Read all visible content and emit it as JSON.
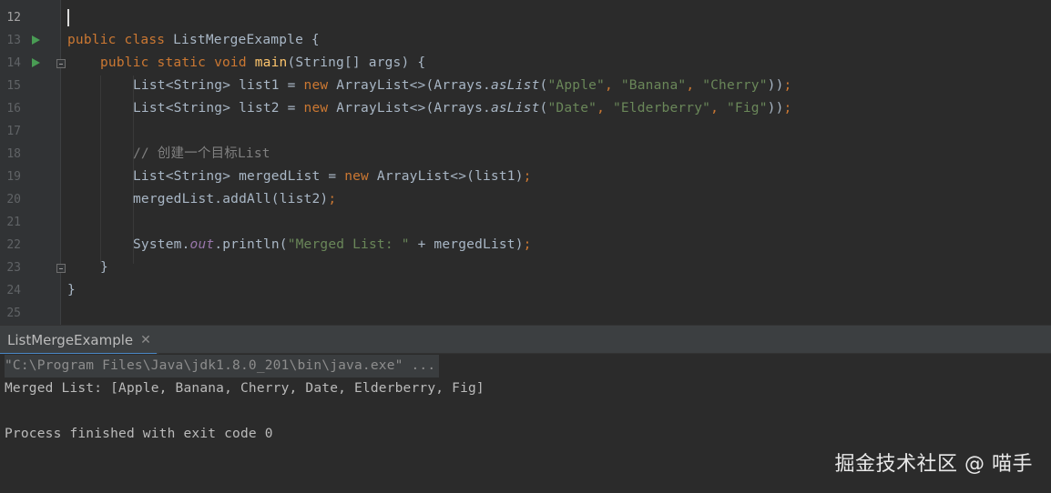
{
  "editor": {
    "line_numbers": [
      "12",
      "13",
      "14",
      "15",
      "16",
      "17",
      "18",
      "19",
      "20",
      "21",
      "22",
      "23",
      "24",
      "25"
    ],
    "lines": {
      "l13": {
        "kw1": "public",
        "kw2": "class",
        "rest": " ListMergeExample {"
      },
      "l14": {
        "kw1": "public",
        "kw2": "static",
        "kw3": "void",
        "fn": "main",
        "rest": "(String[] args) {"
      },
      "l15": {
        "a": "List<String> list1 = ",
        "kw": "new",
        "b": " ArrayList<>(Arrays.",
        "m": "asList",
        "c": "(",
        "s1": "\"Apple\"",
        "sep1": ", ",
        "s2": "\"Banana\"",
        "sep2": ", ",
        "s3": "\"Cherry\"",
        "end": "))",
        "semi": ";"
      },
      "l16": {
        "a": "List<String> list2 = ",
        "kw": "new",
        "b": " ArrayList<>(Arrays.",
        "m": "asList",
        "c": "(",
        "s1": "\"Date\"",
        "sep1": ", ",
        "s2": "\"Elderberry\"",
        "sep2": ", ",
        "s3": "\"Fig\"",
        "end": "))",
        "semi": ";"
      },
      "l18": {
        "comment": "// 创建一个目标List"
      },
      "l19": {
        "a": "List<String> mergedList = ",
        "kw": "new",
        "b": " ArrayList<>(list1)",
        "semi": ";"
      },
      "l20": {
        "a": "mergedList.addAll(list2)",
        "semi": ";"
      },
      "l22": {
        "a": "System.",
        "fld": "out",
        "b": ".println(",
        "s": "\"Merged List: \"",
        "c": " + mergedList)",
        "semi": ";"
      },
      "l23": {
        "a": "}"
      },
      "l24": {
        "a": "}"
      }
    }
  },
  "run_panel": {
    "tab_label": "ListMergeExample",
    "close_glyph": "✕",
    "output": [
      "\"C:\\Program Files\\Java\\jdk1.8.0_201\\bin\\java.exe\" ...",
      "Merged List: [Apple, Banana, Cherry, Date, Elderberry, Fig]",
      "",
      "Process finished with exit code 0"
    ]
  },
  "watermark": "掘金技术社区 @ 喵手",
  "colors": {
    "background": "#2b2b2b",
    "gutter": "#313335",
    "keyword": "#cc7832",
    "method": "#ffc66d",
    "string": "#6a8759",
    "comment": "#808080",
    "field": "#9876aa",
    "run_icon": "#499c54"
  },
  "icons": {
    "run_gutter": "run-triangle-icon",
    "fold": "fold-icon",
    "close": "close-icon"
  }
}
